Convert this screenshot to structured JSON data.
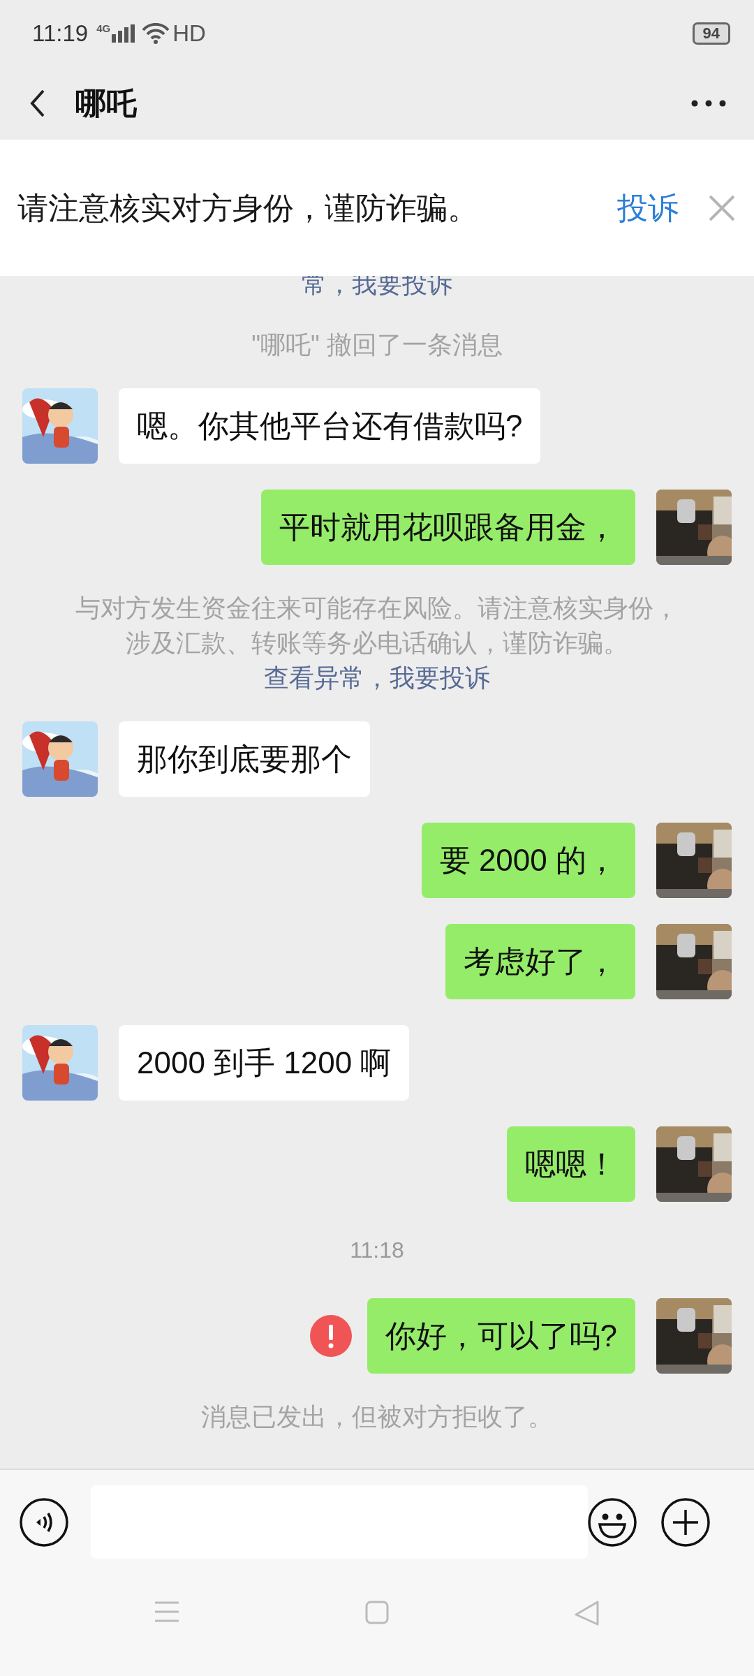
{
  "status_bar": {
    "time": "11:19",
    "network": "4G",
    "quality": "HD",
    "battery": "94"
  },
  "header": {
    "title": "哪吒"
  },
  "banner": {
    "text": "请注意核实对方身份，谨防诈骗。",
    "action": "投诉"
  },
  "messages": [
    {
      "kind": "system",
      "parts": [
        {
          "text": "常，我要投诉",
          "link": true
        }
      ]
    },
    {
      "kind": "system",
      "parts": [
        {
          "text": "\"哪吒\" 撤回了一条消息",
          "link": false
        }
      ]
    },
    {
      "kind": "incoming",
      "text": "嗯。你其他平台还有借款吗?"
    },
    {
      "kind": "outgoing",
      "text": "平时就用花呗跟备用金，",
      "failed": false
    },
    {
      "kind": "system",
      "parts": [
        {
          "text": "与对方发生资金往来可能存在风险。请注意核实身份，涉及汇款、转账等务必电话确认，谨防诈骗。",
          "link": false
        },
        {
          "text": "查看异常，我要投诉",
          "link": true
        }
      ]
    },
    {
      "kind": "incoming",
      "text": "那你到底要那个"
    },
    {
      "kind": "outgoing",
      "text": "要 2000 的，",
      "failed": false
    },
    {
      "kind": "outgoing",
      "text": "考虑好了，",
      "failed": false
    },
    {
      "kind": "incoming",
      "text": "2000 到手 1200 啊"
    },
    {
      "kind": "outgoing",
      "text": "嗯嗯！",
      "failed": false
    },
    {
      "kind": "time",
      "text": "11:18"
    },
    {
      "kind": "outgoing",
      "text": "你好，可以了吗?",
      "failed": true
    },
    {
      "kind": "system",
      "parts": [
        {
          "text": "消息已发出，但被对方拒收了。",
          "link": false
        }
      ]
    }
  ]
}
